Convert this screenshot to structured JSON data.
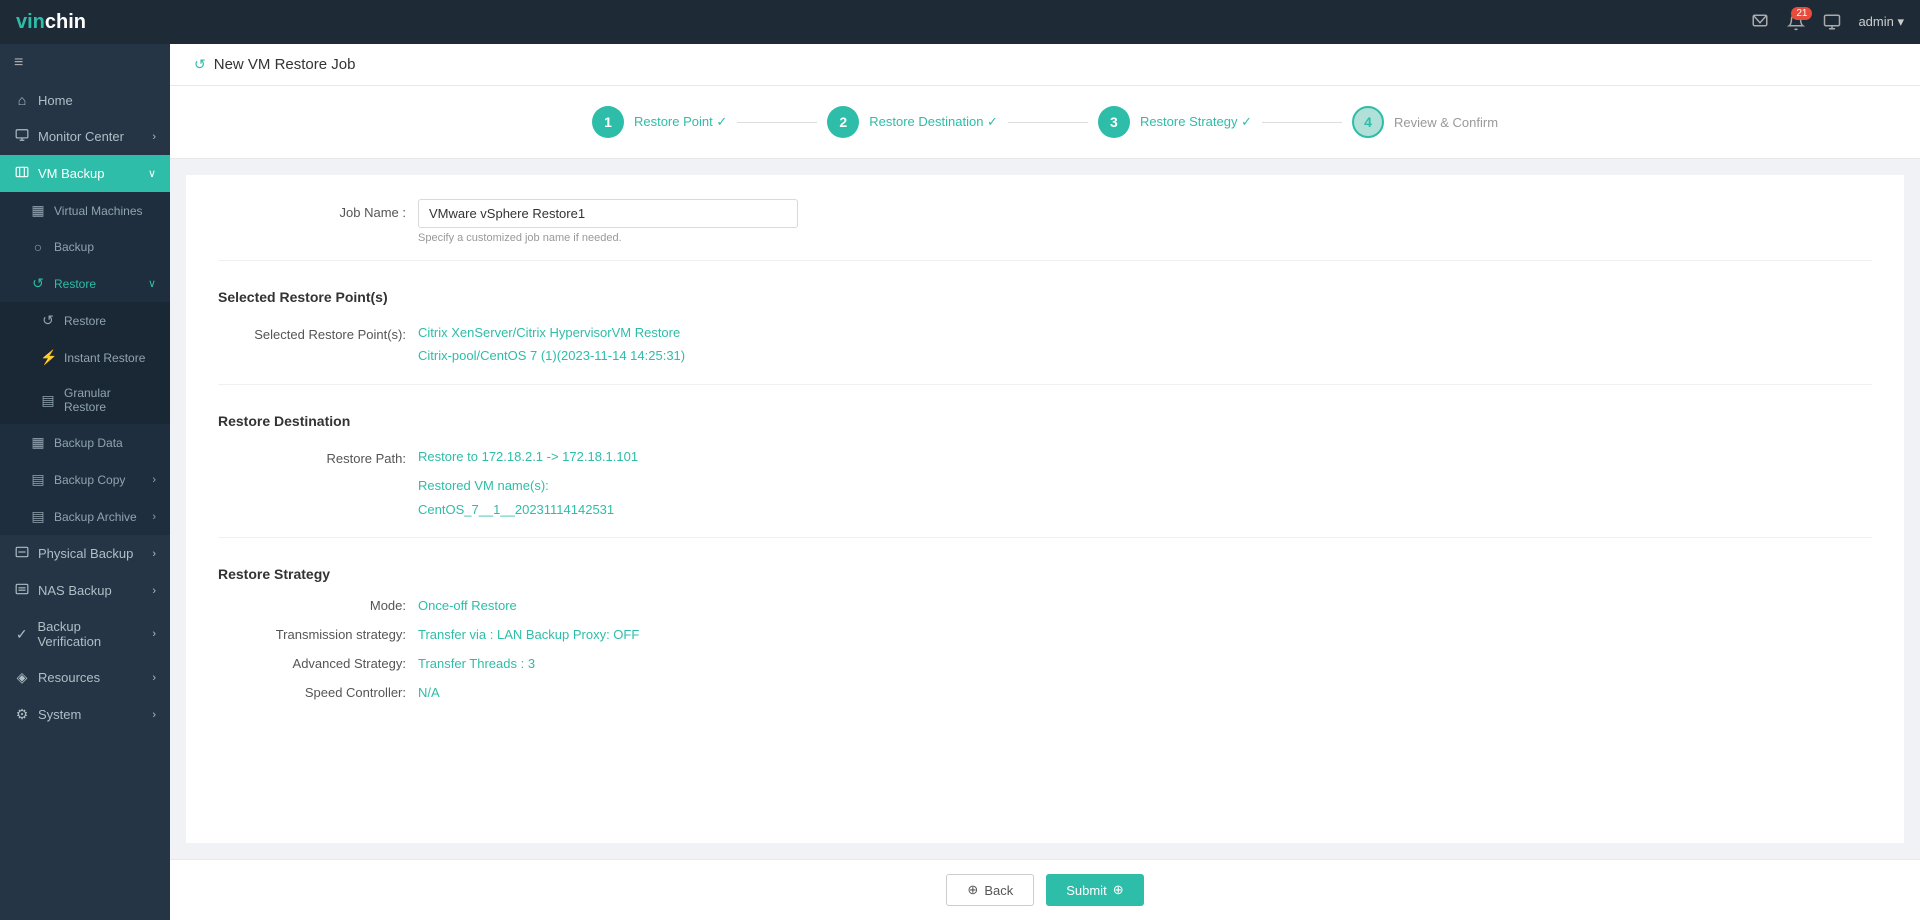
{
  "navbar": {
    "logo_prefix": "vin",
    "logo_suffix": "chin",
    "notification_count": "21",
    "admin_label": "admin ▾"
  },
  "sidebar": {
    "toggle_icon": "≡",
    "items": [
      {
        "id": "home",
        "label": "Home",
        "icon": "⌂",
        "active": false
      },
      {
        "id": "monitor-center",
        "label": "Monitor Center",
        "icon": "📊",
        "active": false,
        "has_arrow": true
      },
      {
        "id": "vm-backup",
        "label": "VM Backup",
        "icon": "💾",
        "active": true,
        "has_arrow": true
      },
      {
        "id": "virtual-machines",
        "label": "Virtual Machines",
        "icon": "▦",
        "sub": true
      },
      {
        "id": "backup",
        "label": "Backup",
        "icon": "○",
        "sub": true
      },
      {
        "id": "restore",
        "label": "Restore",
        "icon": "↺",
        "sub": true,
        "active_sub": true,
        "has_arrow": true
      },
      {
        "id": "restore-sub",
        "label": "Restore",
        "icon": "↺",
        "sub2": true
      },
      {
        "id": "instant-restore",
        "label": "Instant Restore",
        "icon": "⚡",
        "sub2": true
      },
      {
        "id": "granular-restore",
        "label": "Granular Restore",
        "icon": "▤",
        "sub2": true
      },
      {
        "id": "backup-data",
        "label": "Backup Data",
        "icon": "▦",
        "sub": true
      },
      {
        "id": "backup-copy",
        "label": "Backup Copy",
        "icon": "▤",
        "sub": true,
        "has_arrow": true
      },
      {
        "id": "backup-archive",
        "label": "Backup Archive",
        "icon": "▤",
        "sub": true,
        "has_arrow": true
      },
      {
        "id": "physical-backup",
        "label": "Physical Backup",
        "icon": "▦",
        "active": false,
        "has_arrow": true
      },
      {
        "id": "nas-backup",
        "label": "NAS Backup",
        "icon": "▦",
        "active": false,
        "has_arrow": true
      },
      {
        "id": "backup-verification",
        "label": "Backup Verification",
        "icon": "✓",
        "active": false,
        "has_arrow": true
      },
      {
        "id": "resources",
        "label": "Resources",
        "icon": "◈",
        "active": false,
        "has_arrow": true
      },
      {
        "id": "system",
        "label": "System",
        "icon": "⚙",
        "active": false,
        "has_arrow": true
      }
    ]
  },
  "page": {
    "header_icon": "↺",
    "header_title": "New VM Restore Job",
    "wizard": {
      "steps": [
        {
          "num": "1",
          "label": "Restore Point ✓",
          "done": true
        },
        {
          "num": "2",
          "label": "Restore Destination ✓",
          "done": true
        },
        {
          "num": "3",
          "label": "Restore Strategy ✓",
          "done": true
        },
        {
          "num": "4",
          "label": "Review & Confirm",
          "active": true
        }
      ]
    },
    "job_name_label": "Job Name :",
    "job_name_value": "VMware vSphere Restore1",
    "job_name_hint": "Specify a customized job name if needed.",
    "selected_restore_points_heading": "Selected Restore Point(s)",
    "selected_restore_label": "Selected Restore Point(s):",
    "selected_restore_line1": "Citrix XenServer/Citrix HypervisorVM Restore",
    "selected_restore_line2": "Citrix-pool/CentOS 7 (1)(2023-11-14 14:25:31)",
    "restore_destination_heading": "Restore Destination",
    "restore_path_label": "Restore Path:",
    "restore_path_value": "Restore to 172.18.2.1 -> 172.18.1.101",
    "restored_vm_label": "Restored VM name(s):",
    "restored_vm_value": "CentOS_7__1__20231114142531",
    "restore_strategy_heading": "Restore Strategy",
    "mode_label": "Mode:",
    "mode_value": "Once-off Restore",
    "transmission_label": "Transmission strategy:",
    "transmission_value": "Transfer via : LAN Backup Proxy: OFF",
    "advanced_label": "Advanced Strategy:",
    "advanced_value": "Transfer Threads : 3",
    "speed_label": "Speed Controller:",
    "speed_value": "N/A",
    "back_label": "Back",
    "submit_label": "Submit"
  }
}
